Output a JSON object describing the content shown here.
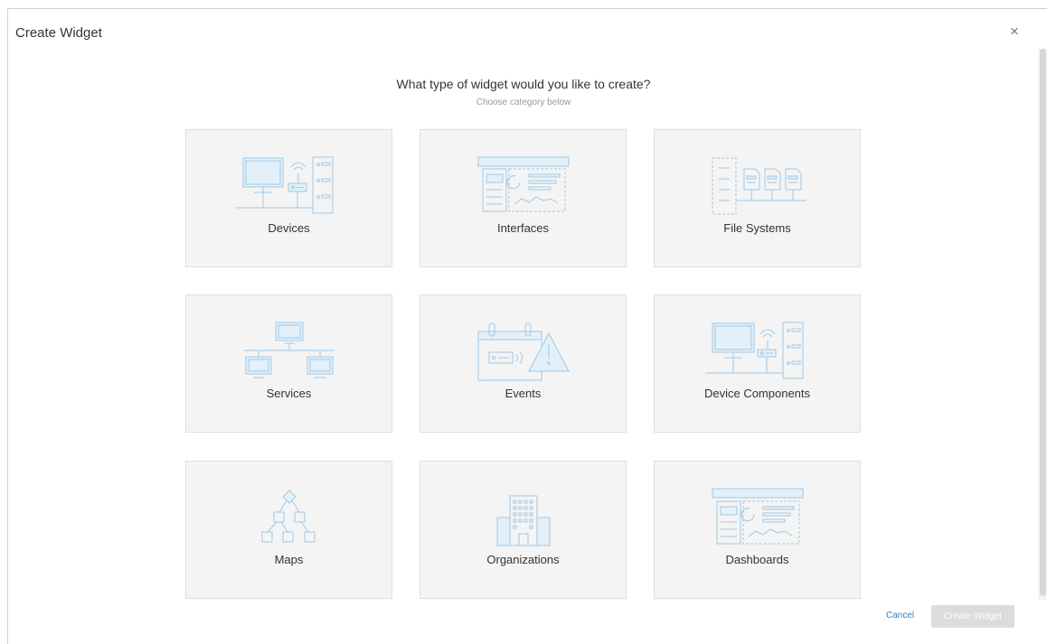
{
  "dialog": {
    "title": "Create Widget",
    "close_glyph": "×",
    "question": "What type of widget would you like to create?",
    "subtitle": "Choose category below"
  },
  "categories": [
    {
      "label": "Devices",
      "icon": "devices-icon"
    },
    {
      "label": "Interfaces",
      "icon": "interfaces-icon"
    },
    {
      "label": "File Systems",
      "icon": "file-systems-icon"
    },
    {
      "label": "Services",
      "icon": "services-icon"
    },
    {
      "label": "Events",
      "icon": "events-icon"
    },
    {
      "label": "Device Components",
      "icon": "device-components-icon"
    },
    {
      "label": "Maps",
      "icon": "maps-icon"
    },
    {
      "label": "Organizations",
      "icon": "organizations-icon"
    },
    {
      "label": "Dashboards",
      "icon": "dashboards-icon"
    }
  ],
  "footer": {
    "cancel_label": "Cancel",
    "create_label": "Create Widget"
  },
  "colors": {
    "card_bg": "#f4f4f4",
    "illustration": "#9fc9e6",
    "link": "#2f80c5",
    "disabled_button": "#dcdcdc"
  }
}
